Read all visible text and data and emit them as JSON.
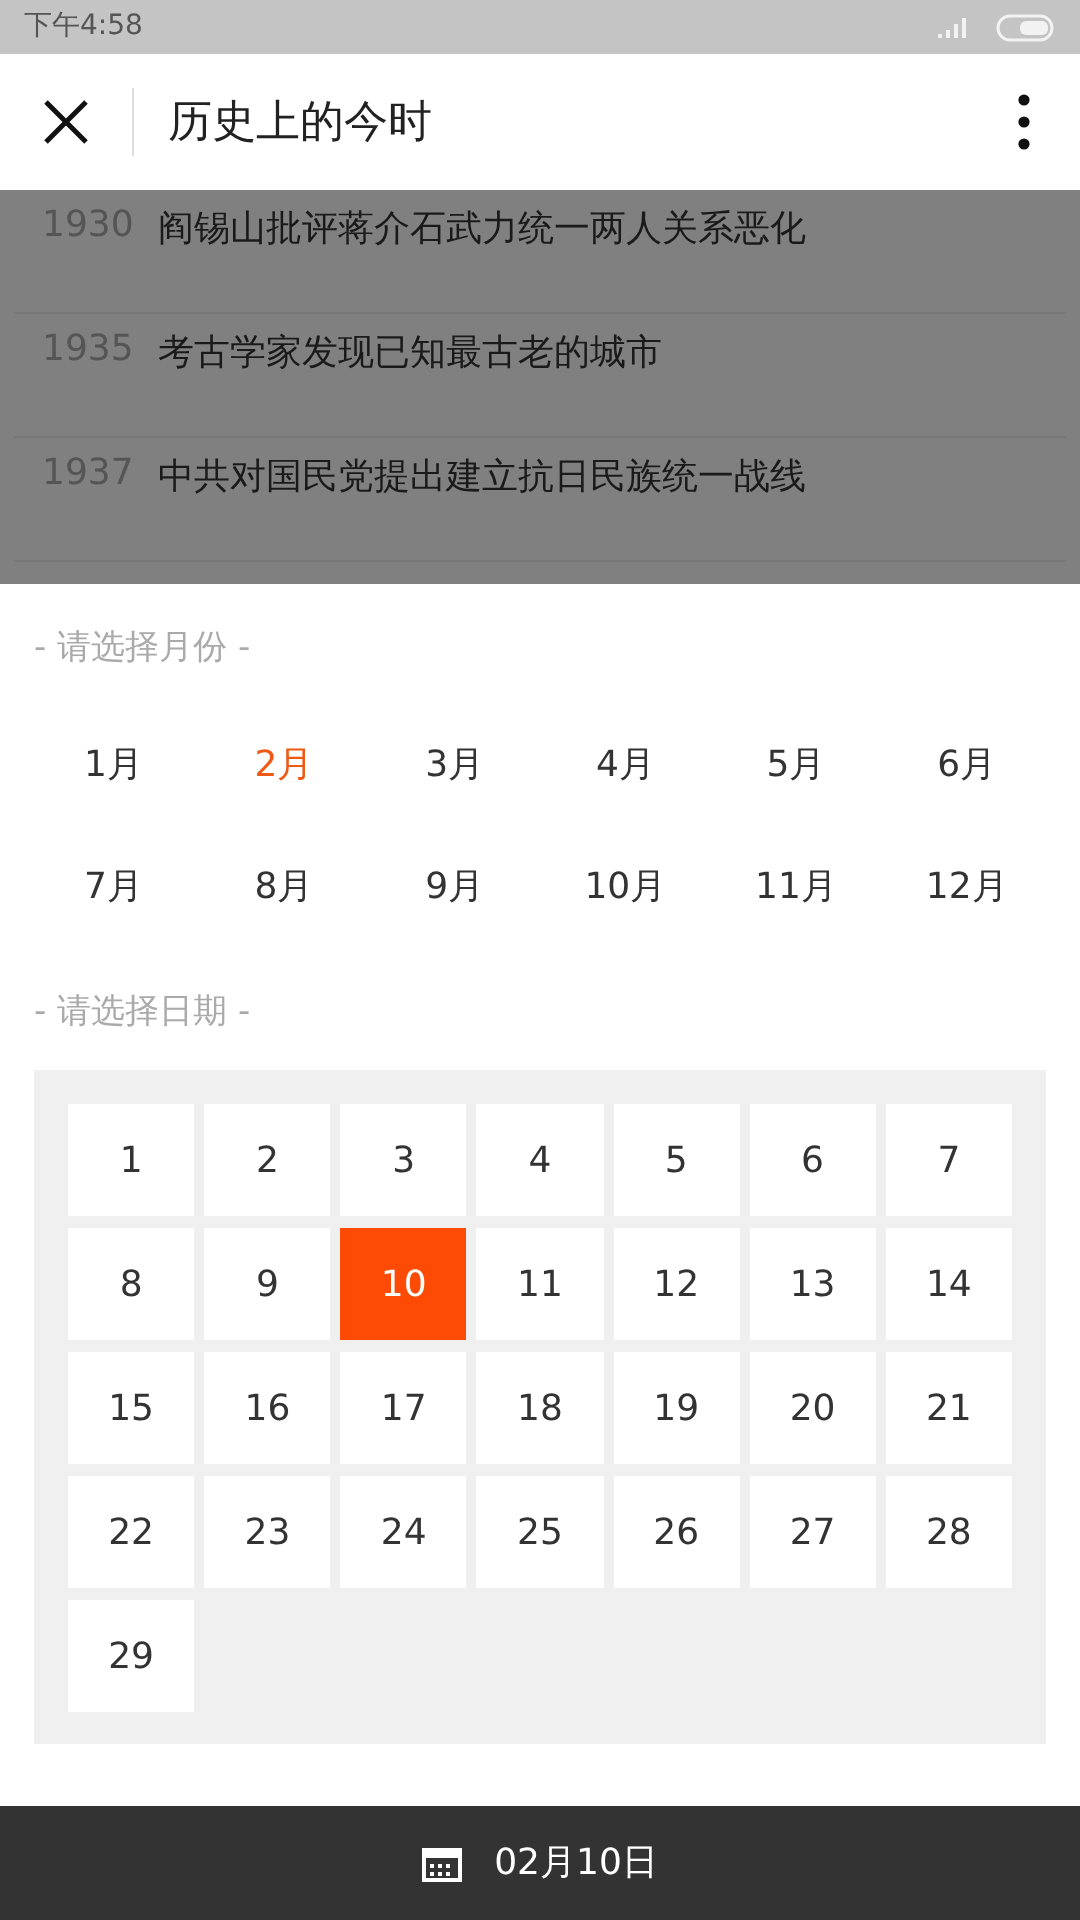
{
  "status_bar": {
    "time": "下午4:58"
  },
  "header": {
    "title": "历史上的今时"
  },
  "events": [
    {
      "year": "1930",
      "text": "阎锡山批评蒋介石武力统一两人关系恶化"
    },
    {
      "year": "1935",
      "text": "考古学家发现已知最古老的城市"
    },
    {
      "year": "1937",
      "text": "中共对国民党提出建立抗日民族统一战线"
    }
  ],
  "month_picker": {
    "title": "- 请选择月份 -",
    "months": [
      {
        "label": "1月",
        "selected": false
      },
      {
        "label": "2月",
        "selected": true
      },
      {
        "label": "3月",
        "selected": false
      },
      {
        "label": "4月",
        "selected": false
      },
      {
        "label": "5月",
        "selected": false
      },
      {
        "label": "6月",
        "selected": false
      },
      {
        "label": "7月",
        "selected": false
      },
      {
        "label": "8月",
        "selected": false
      },
      {
        "label": "9月",
        "selected": false
      },
      {
        "label": "10月",
        "selected": false
      },
      {
        "label": "11月",
        "selected": false
      },
      {
        "label": "12月",
        "selected": false
      }
    ]
  },
  "day_picker": {
    "title": "- 请选择日期 -",
    "days": [
      {
        "label": "1",
        "selected": false
      },
      {
        "label": "2",
        "selected": false
      },
      {
        "label": "3",
        "selected": false
      },
      {
        "label": "4",
        "selected": false
      },
      {
        "label": "5",
        "selected": false
      },
      {
        "label": "6",
        "selected": false
      },
      {
        "label": "7",
        "selected": false
      },
      {
        "label": "8",
        "selected": false
      },
      {
        "label": "9",
        "selected": false
      },
      {
        "label": "10",
        "selected": true
      },
      {
        "label": "11",
        "selected": false
      },
      {
        "label": "12",
        "selected": false
      },
      {
        "label": "13",
        "selected": false
      },
      {
        "label": "14",
        "selected": false
      },
      {
        "label": "15",
        "selected": false
      },
      {
        "label": "16",
        "selected": false
      },
      {
        "label": "17",
        "selected": false
      },
      {
        "label": "18",
        "selected": false
      },
      {
        "label": "19",
        "selected": false
      },
      {
        "label": "20",
        "selected": false
      },
      {
        "label": "21",
        "selected": false
      },
      {
        "label": "22",
        "selected": false
      },
      {
        "label": "23",
        "selected": false
      },
      {
        "label": "24",
        "selected": false
      },
      {
        "label": "25",
        "selected": false
      },
      {
        "label": "26",
        "selected": false
      },
      {
        "label": "27",
        "selected": false
      },
      {
        "label": "28",
        "selected": false
      },
      {
        "label": "29",
        "selected": false
      }
    ]
  },
  "bottom_bar": {
    "date": "02月10日"
  }
}
